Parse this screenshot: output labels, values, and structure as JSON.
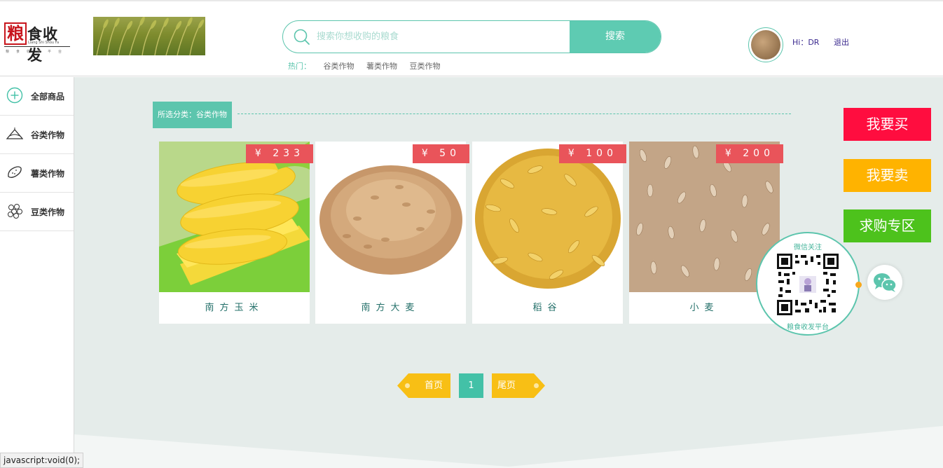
{
  "header": {
    "logo": {
      "mark": "粮",
      "text": "食收发",
      "subtitle": "Liang Shi Shou Fa",
      "tagline": "粮食收发平台"
    },
    "search": {
      "placeholder": "搜索你想收购的粮食",
      "button": "搜索"
    },
    "hot": {
      "label": "热门：",
      "links": [
        "谷类作物",
        "薯类作物",
        "豆类作物"
      ]
    },
    "user": {
      "greeting": "Hi：DR",
      "logout": "退出"
    }
  },
  "sidebar": {
    "items": [
      {
        "label": "全部商品",
        "icon": "plus-circle-icon"
      },
      {
        "label": "谷类作物",
        "icon": "grain-icon"
      },
      {
        "label": "薯类作物",
        "icon": "potato-icon"
      },
      {
        "label": "豆类作物",
        "icon": "bean-icon"
      }
    ]
  },
  "main": {
    "category_tag": "所选分类：谷类作物",
    "products": [
      {
        "name": "南方玉米",
        "price": "¥ 233"
      },
      {
        "name": "南方大麦",
        "price": "¥ 50"
      },
      {
        "name": "稻谷",
        "price": "¥ 100"
      },
      {
        "name": "小麦",
        "price": "¥ 200"
      }
    ],
    "pagination": {
      "first": "首页",
      "current": "1",
      "last": "尾页"
    }
  },
  "actions": {
    "buy": "我要买",
    "sell": "我要卖",
    "wanted": "求购专区"
  },
  "qr": {
    "title": "微信关注",
    "caption": "粮食收发平台"
  },
  "status_bar": "javascript:void(0);",
  "colors": {
    "accent": "#5cc5ad",
    "price_tag": "#e9545a",
    "buy": "#ff0d3f",
    "sell": "#ffb300",
    "wanted": "#4dc21c",
    "pagination": "#f8bf15"
  }
}
